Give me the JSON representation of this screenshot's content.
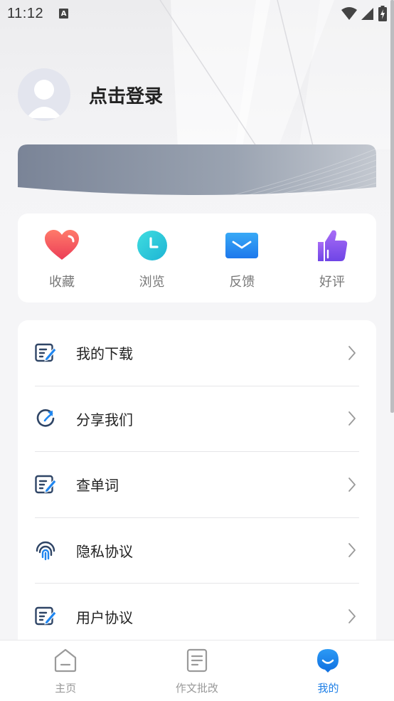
{
  "status_bar": {
    "time": "11:12",
    "notification_icon": "A"
  },
  "profile": {
    "login_label": "点击登录",
    "avatar_icon": "default-avatar-icon"
  },
  "quick_actions": [
    {
      "label": "收藏",
      "icon": "heart-icon",
      "color": "#f0504f"
    },
    {
      "label": "浏览",
      "icon": "clock-icon",
      "color": "#24c6d6"
    },
    {
      "label": "反馈",
      "icon": "mail-icon",
      "color": "#2a8cf0"
    },
    {
      "label": "好评",
      "icon": "thumbs-up-icon",
      "color": "#8a55ee"
    }
  ],
  "menu": [
    {
      "label": "我的下载",
      "icon": "edit-doc-icon"
    },
    {
      "label": "分享我们",
      "icon": "refresh-icon"
    },
    {
      "label": "查单词",
      "icon": "edit-doc-icon"
    },
    {
      "label": "隐私协议",
      "icon": "fingerprint-icon"
    },
    {
      "label": "用户协议",
      "icon": "edit-doc-icon"
    }
  ],
  "bottom_nav": [
    {
      "label": "主页",
      "icon": "home-icon",
      "active": false
    },
    {
      "label": "作文批改",
      "icon": "document-icon",
      "active": false
    },
    {
      "label": "我的",
      "icon": "profile-face-icon",
      "active": true
    }
  ],
  "colors": {
    "accent": "#1e7fe6",
    "menu_icon_stroke": "#2f4566",
    "menu_icon_blue": "#1f86f0"
  }
}
